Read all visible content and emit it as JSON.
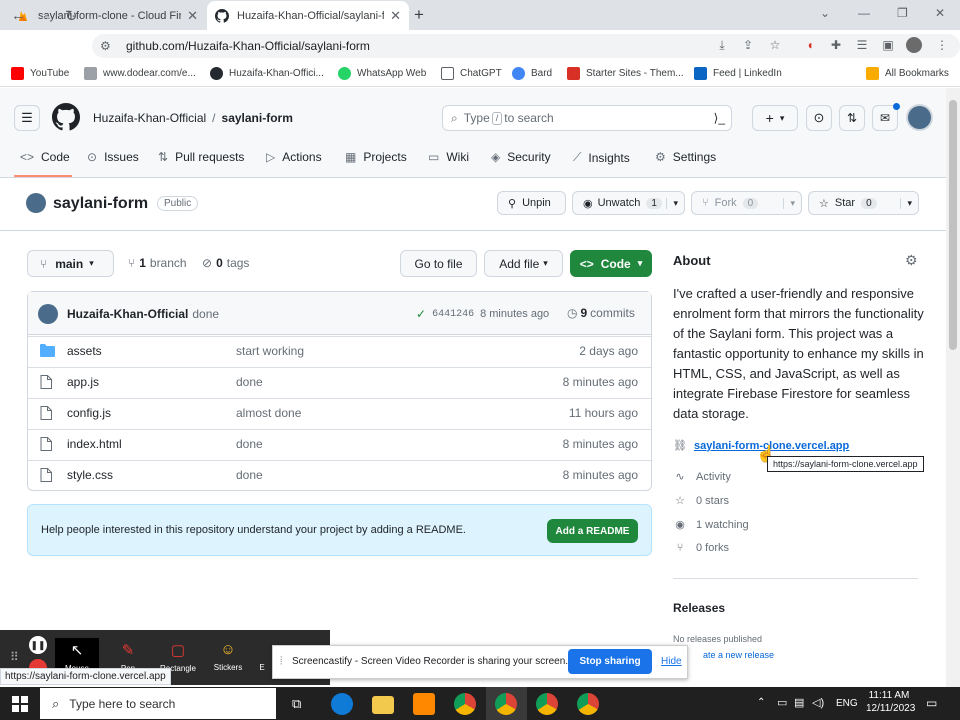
{
  "browser": {
    "tabs": [
      {
        "title": "saylani-form-clone - Cloud Fires",
        "icon": "firebase-icon"
      },
      {
        "title": "Huzaifa-Khan-Official/saylani-fo",
        "icon": "github-icon"
      }
    ],
    "url": "github.com/Huzaifa-Khan-Official/saylani-form",
    "bookmarks": [
      {
        "label": "YouTube",
        "color": "#ff0000"
      },
      {
        "label": "www.dodear.com/e...",
        "color": "#5f6368"
      },
      {
        "label": "Huzaifa-Khan-Offici...",
        "color": "#24292f"
      },
      {
        "label": "WhatsApp Web",
        "color": "#25d366"
      },
      {
        "label": "ChatGPT",
        "color": "#5f6368"
      },
      {
        "label": "Bard",
        "color": "#4285f4"
      },
      {
        "label": "Starter Sites - Them...",
        "color": "#d93025"
      },
      {
        "label": "Feed | LinkedIn",
        "color": "#0a66c2"
      }
    ],
    "all_bookmarks": "All Bookmarks"
  },
  "github": {
    "owner": "Huzaifa-Khan-Official",
    "separator": "/",
    "repo": "saylani-form",
    "search_prefix": "Type",
    "search_key": "/",
    "search_suffix": "to search",
    "tabs": [
      {
        "label": "Code",
        "icon": "code-icon"
      },
      {
        "label": "Issues",
        "icon": "issue-icon"
      },
      {
        "label": "Pull requests",
        "icon": "pull-request-icon"
      },
      {
        "label": "Actions",
        "icon": "play-icon"
      },
      {
        "label": "Projects",
        "icon": "table-icon"
      },
      {
        "label": "Wiki",
        "icon": "book-icon"
      },
      {
        "label": "Security",
        "icon": "shield-icon"
      },
      {
        "label": "Insights",
        "icon": "graph-icon"
      },
      {
        "label": "Settings",
        "icon": "gear-icon"
      }
    ],
    "visibility": "Public",
    "unpin": "Unpin",
    "unwatch": "Unwatch",
    "watch_count": "1",
    "fork": "Fork",
    "fork_count": "0",
    "star": "Star",
    "star_count": "0",
    "branch": "main",
    "branches": "1",
    "branches_label": "branch",
    "tags": "0",
    "tags_label": "tags",
    "go_to_file": "Go to file",
    "add_file": "Add file",
    "code_button": "Code",
    "commit": {
      "author": "Huzaifa-Khan-Official",
      "message": "done",
      "sha": "6441246",
      "time": "8 minutes ago",
      "count": "9",
      "count_label": "commits"
    },
    "files": [
      {
        "name": "assets",
        "type": "folder",
        "message": "start working",
        "date": "2 days ago"
      },
      {
        "name": "app.js",
        "type": "file",
        "message": "done",
        "date": "8 minutes ago"
      },
      {
        "name": "config.js",
        "type": "file",
        "message": "almost done",
        "date": "11 hours ago"
      },
      {
        "name": "index.html",
        "type": "file",
        "message": "done",
        "date": "8 minutes ago"
      },
      {
        "name": "style.css",
        "type": "file",
        "message": "done",
        "date": "8 minutes ago"
      }
    ],
    "readme_text": "Help people interested in this repository understand your project by adding a README.",
    "add_readme": "Add a README",
    "about": {
      "heading": "About",
      "description": "I've crafted a user-friendly and responsive enrolment form that mirrors the functionality of the Saylani form. This project was a fantastic opportunity to enhance my skills in HTML, CSS, and JavaScript, as well as integrate Firebase Firestore for seamless data storage.",
      "link": "saylani-form-clone.vercel.app",
      "tooltip": "https://saylani-form-clone.vercel.app",
      "activity": "Activity",
      "stars": "0 stars",
      "watching": "1 watching",
      "forks": "0 forks"
    },
    "releases": {
      "heading": "Releases",
      "none": "No releases published",
      "create": "ate a new release"
    }
  },
  "overlays": {
    "castify_tools": [
      "Mouse",
      "Pen",
      "Rectangle",
      "Stickers",
      "E"
    ],
    "share_text": "Screencastify - Screen Video Recorder is sharing your screen.",
    "stop_sharing": "Stop sharing",
    "hide": "Hide",
    "status_url": "https://saylani-form-clone.vercel.app"
  },
  "taskbar": {
    "search_placeholder": "Type here to search",
    "time": "11:11 AM",
    "date": "12/11/2023",
    "lang": "ENG"
  },
  "colors": {
    "primary_green": "#1f883d",
    "link_blue": "#0969da",
    "tab_underline": "#fd8c73"
  }
}
